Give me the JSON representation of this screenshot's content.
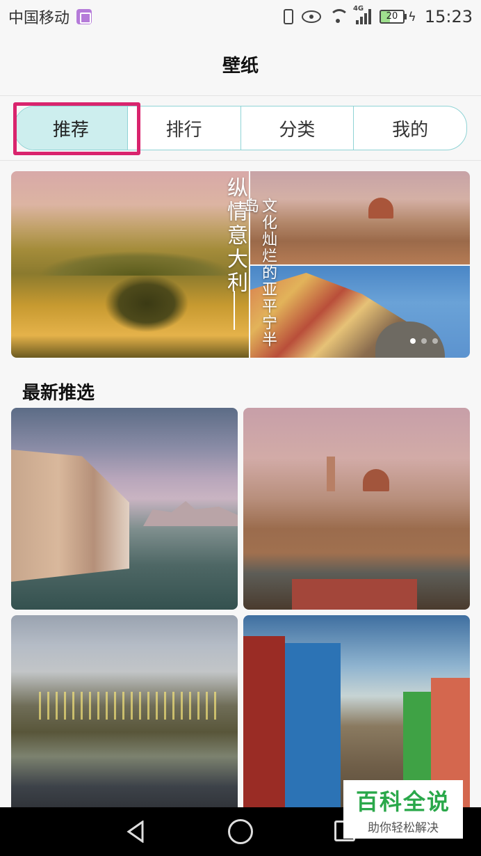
{
  "status_bar": {
    "carrier": "中国移动",
    "network": "4G",
    "battery": "20",
    "time": "15:23"
  },
  "header": {
    "title": "壁纸"
  },
  "tabs": [
    {
      "label": "推荐",
      "active": true
    },
    {
      "label": "排行",
      "active": false
    },
    {
      "label": "分类",
      "active": false
    },
    {
      "label": "我的",
      "active": false
    }
  ],
  "banner": {
    "left_caption": "纵情意大利",
    "right_caption": "文化灿烂的亚平宁半岛",
    "page_count": 3,
    "current_page": 1
  },
  "latest": {
    "title": "最新推选",
    "tiles": [
      "venice-canal",
      "florence-skyline",
      "milan-canal-night",
      "burano-houses"
    ]
  },
  "watermark": {
    "main": "百科全说",
    "sub": "助你轻松解决"
  },
  "colors": {
    "accent": "#8fd3d5",
    "tab_active_bg": "#cdeeee",
    "highlight": "#d9246d"
  }
}
